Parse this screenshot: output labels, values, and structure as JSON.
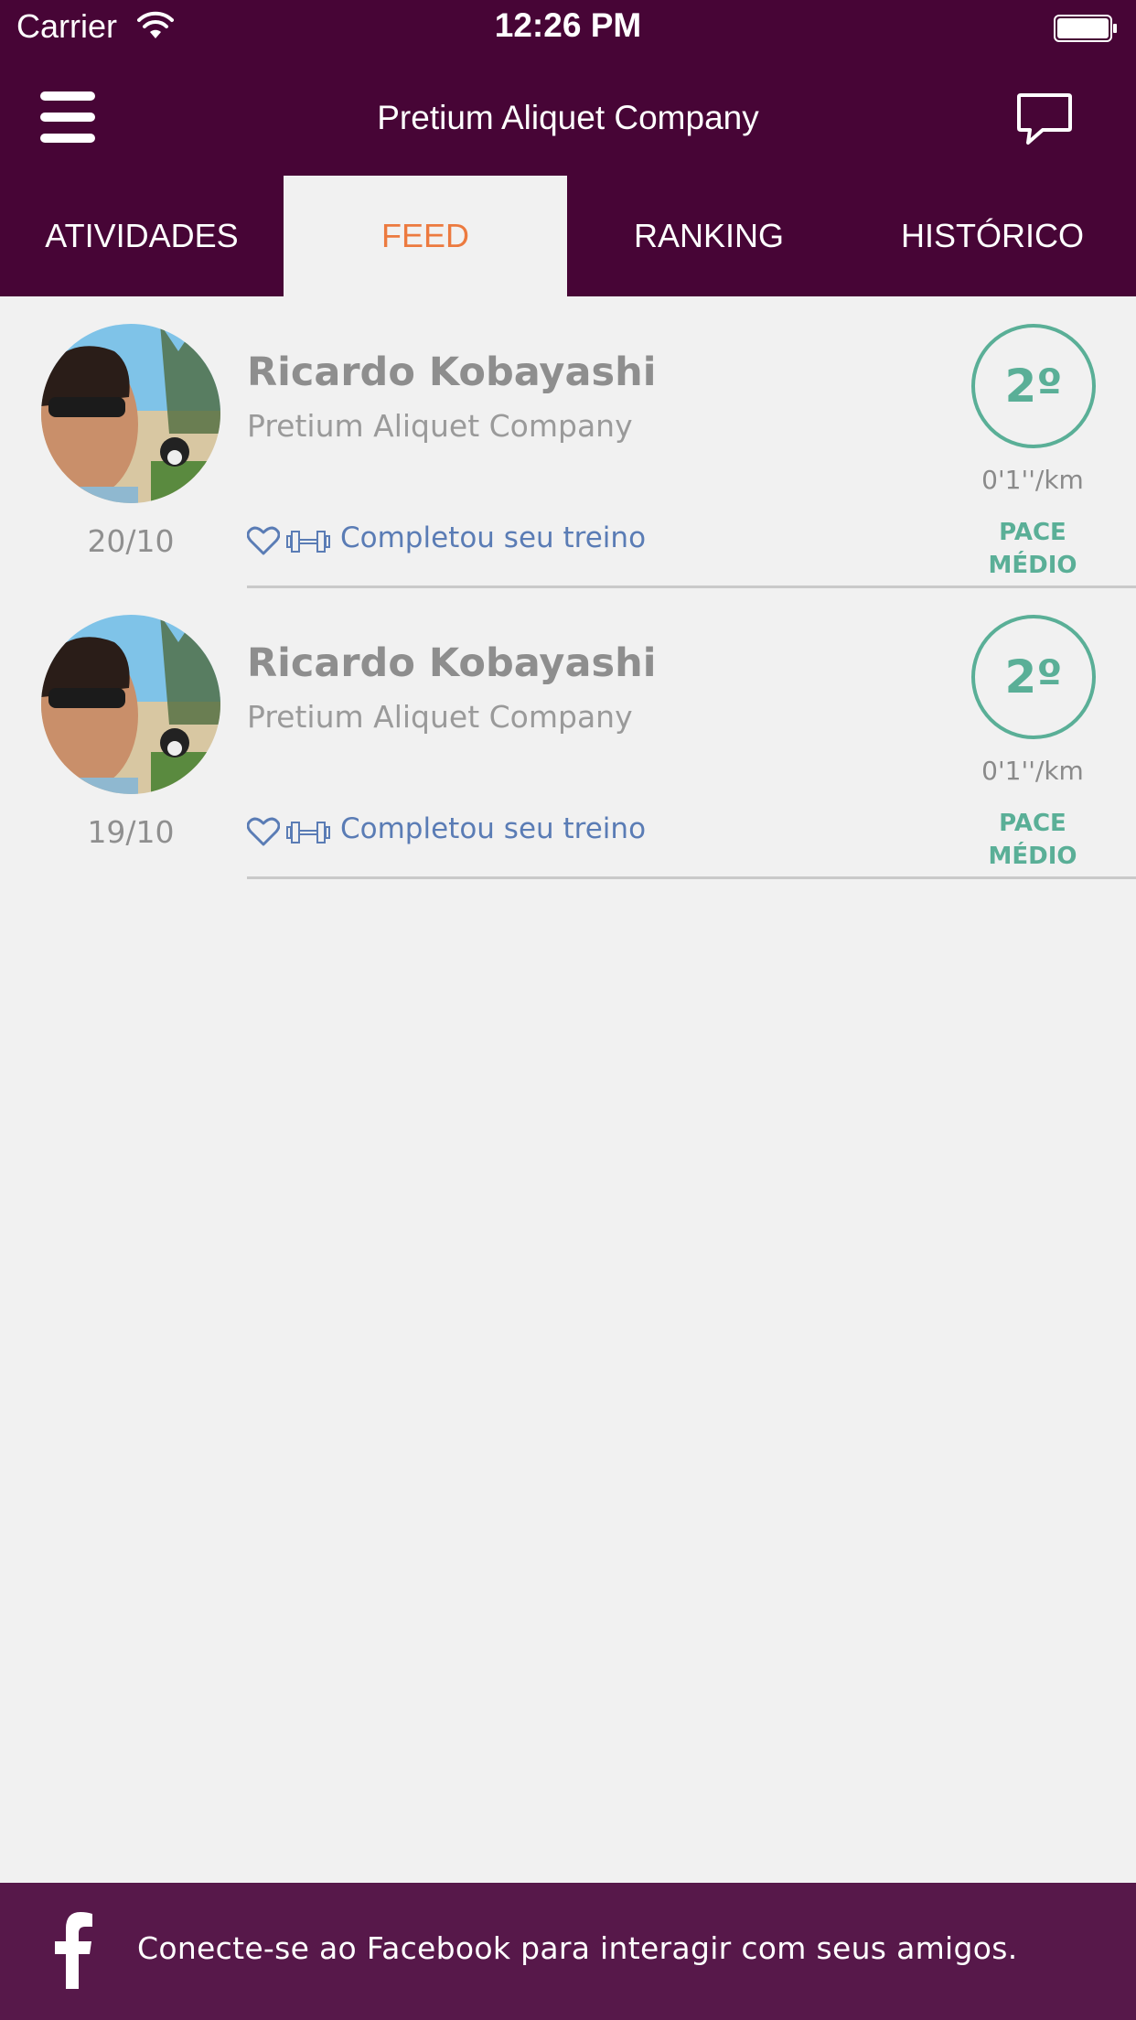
{
  "status_bar": {
    "carrier": "Carrier",
    "time": "12:26 PM"
  },
  "header": {
    "title": "Pretium Aliquet Company"
  },
  "tabs": [
    {
      "label": "ATIVIDADES",
      "active": false
    },
    {
      "label": "FEED",
      "active": true
    },
    {
      "label": "RANKING",
      "active": false
    },
    {
      "label": "HISTÓRICO",
      "active": false
    }
  ],
  "feed": [
    {
      "name": "Ricardo Kobayashi",
      "company": "Pretium Aliquet Company",
      "date": "20/10",
      "action": "Completou seu treino",
      "rank": "2º",
      "pace_value": "0'1''/km",
      "pace_label_line1": "PACE",
      "pace_label_line2": "MÉDIO"
    },
    {
      "name": "Ricardo Kobayashi",
      "company": "Pretium Aliquet Company",
      "date": "19/10",
      "action": "Completou seu treino",
      "rank": "2º",
      "pace_value": "0'1''/km",
      "pace_label_line1": "PACE",
      "pace_label_line2": "MÉDIO"
    }
  ],
  "facebook_banner": {
    "text": "Conecte-se ao Facebook para interagir com seus amigos."
  },
  "icons": {
    "menu": "hamburger-menu-icon",
    "chat": "chat-bubble-icon",
    "like": "heart-icon",
    "workout": "dumbbell-icon",
    "facebook": "facebook-icon"
  },
  "colors": {
    "header_bg": "#470536",
    "banner_bg": "#57184a",
    "active_tab_text": "#ec7a3f",
    "accent_green": "#5aaf97",
    "action_blue": "#5a7cb5"
  }
}
